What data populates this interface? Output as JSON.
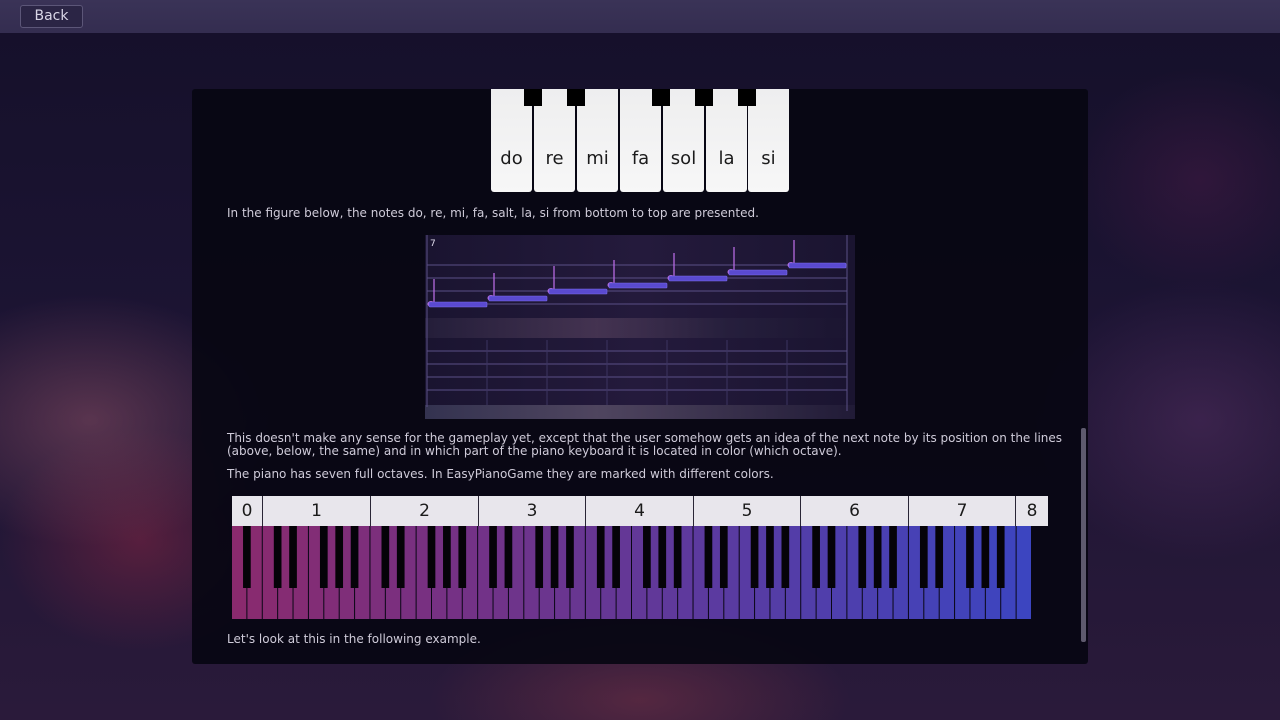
{
  "topbar": {
    "back_label": "Back"
  },
  "solfege": {
    "notes": [
      "do",
      "re",
      "mi",
      "fa",
      "sol",
      "la",
      "si"
    ]
  },
  "text": {
    "para1": "In the figure below, the notes do, re, mi, fa, salt, la, si from bottom to top are presented.",
    "para2": "This doesn't make any sense for the gameplay yet, except that the user somehow gets an idea of the next note by its position on the lines (above, below, the same) and in which part of the piano keyboard it is located in color (which octave).",
    "para3": "The piano has seven full octaves. In EasyPianoGame they are marked with different colors.",
    "para4": "Let's look at this in the following example."
  },
  "staff": {
    "octave_number": "7"
  },
  "octaves": {
    "labels": [
      "0",
      "1",
      "2",
      "3",
      "4",
      "5",
      "6",
      "7",
      "8"
    ]
  },
  "colors": {
    "octave_gradient_start": "#8a2a6e",
    "octave_gradient_end": "#3c45c0",
    "note_fill": "#5a4ad0",
    "note_stem": "#b56ae0",
    "staff_line": "#5a4f86"
  }
}
